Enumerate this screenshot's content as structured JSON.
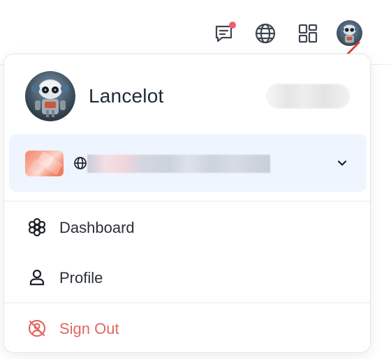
{
  "topbar": {
    "icons": [
      "chat-notification-icon",
      "globe-icon",
      "grid-apps-icon",
      "robot-avatar"
    ],
    "notification_color": "#ef5f6b"
  },
  "account_menu": {
    "username": "Lancelot",
    "organization": {
      "icon": "globe-icon",
      "logo": "orange-hexagon-logo",
      "chevron": "chevron-down-icon",
      "background": "#eff5fe"
    },
    "items": [
      {
        "label": "Dashboard",
        "icon": "flower-dashboard-icon"
      },
      {
        "label": "Profile",
        "icon": "user-icon"
      },
      {
        "label": "Sign Out",
        "icon": "signout-icon",
        "color": "#e06666"
      }
    ]
  },
  "colors": {
    "accent_red": "#e53935",
    "danger_text": "#e06666",
    "org_row_bg": "#eff5fe"
  }
}
